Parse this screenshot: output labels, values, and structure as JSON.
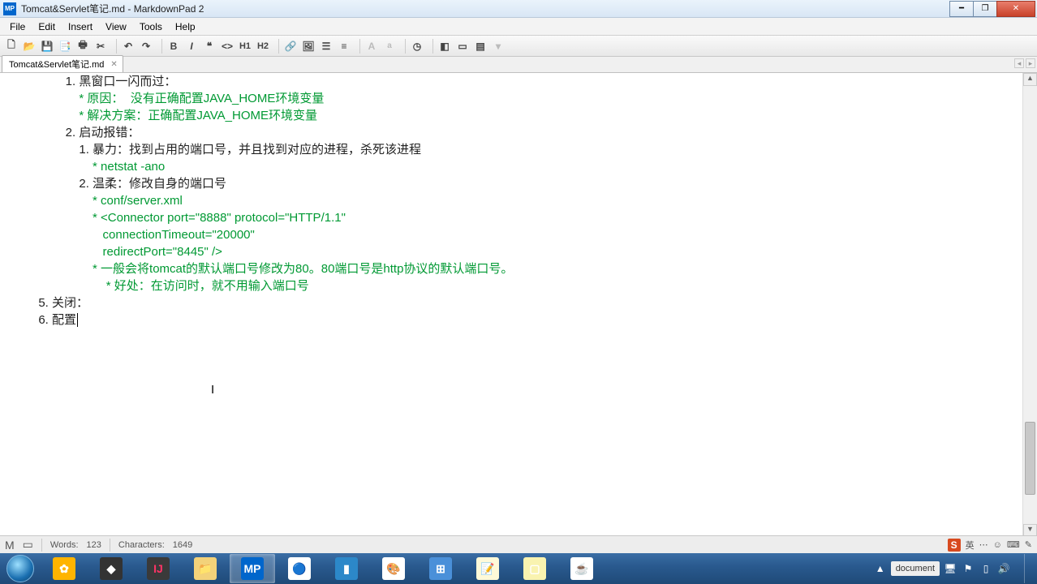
{
  "window": {
    "app_icon_text": "MP",
    "title": "Tomcat&Servlet笔记.md - MarkdownPad 2"
  },
  "menu": {
    "file": "File",
    "edit": "Edit",
    "insert": "Insert",
    "view": "View",
    "tools": "Tools",
    "help": "Help"
  },
  "tabs": {
    "tab1": "Tomcat&Servlet笔记.md"
  },
  "content": {
    "l01": "                1. 黑窗口一闪而过：",
    "l02": "                    * 原因：  没有正确配置JAVA_HOME环境变量",
    "l03": "                    * 解决方案：正确配置JAVA_HOME环境变量",
    "l04": "",
    "l05": "                2. 启动报错：",
    "l06": "                    1. 暴力：找到占用的端口号，并且找到对应的进程，杀死该进程",
    "l07": "                        * netstat -ano",
    "l08": "                    2. 温柔：修改自身的端口号",
    "l09": "                        * conf/server.xml",
    "l10": "                        * <Connector port=\"8888\" protocol=\"HTTP/1.1\"",
    "l11": "                           connectionTimeout=\"20000\"",
    "l12": "                           redirectPort=\"8445\" />",
    "l13": "                        * 一般会将tomcat的默认端口号修改为80。80端口号是http协议的默认端口号。",
    "l14": "                            * 好处：在访问时，就不用输入端口号",
    "l15": "        5. 关闭：",
    "l16": "        6. 配置"
  },
  "status": {
    "words_label": "Words:",
    "words": "123",
    "chars_label": "Characters:",
    "chars": "1649",
    "ime_lang": "英",
    "ime_s": "S"
  },
  "tray": {
    "ime_text": "document",
    "time": "",
    "date": ""
  }
}
